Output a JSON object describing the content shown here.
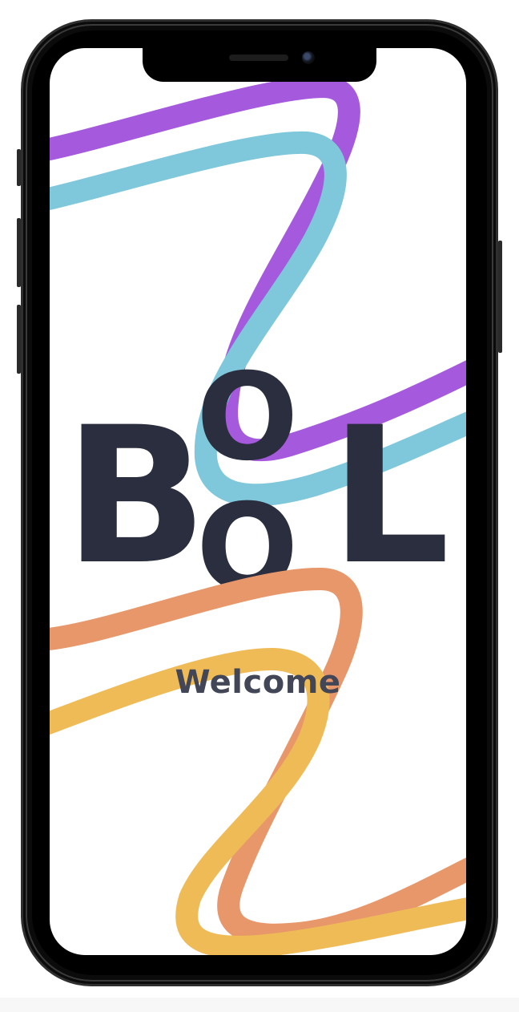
{
  "app": {
    "logo": {
      "letters": [
        "B",
        "O",
        "O",
        "L"
      ]
    },
    "welcome_text": "Welcome"
  },
  "colors": {
    "background": "#ffffff",
    "logo_text": "#2b2e3e",
    "welcome_text": "#424656",
    "purple_ribbon": "#a559dc",
    "blue_ribbon": "#7fc8dc",
    "orange_ribbon": "#e8976a",
    "yellow_ribbon": "#efbb57",
    "device_frame": "#0d0d0d"
  },
  "icons": {
    "front_camera": "camera-icon",
    "earpiece": "speaker-icon"
  }
}
